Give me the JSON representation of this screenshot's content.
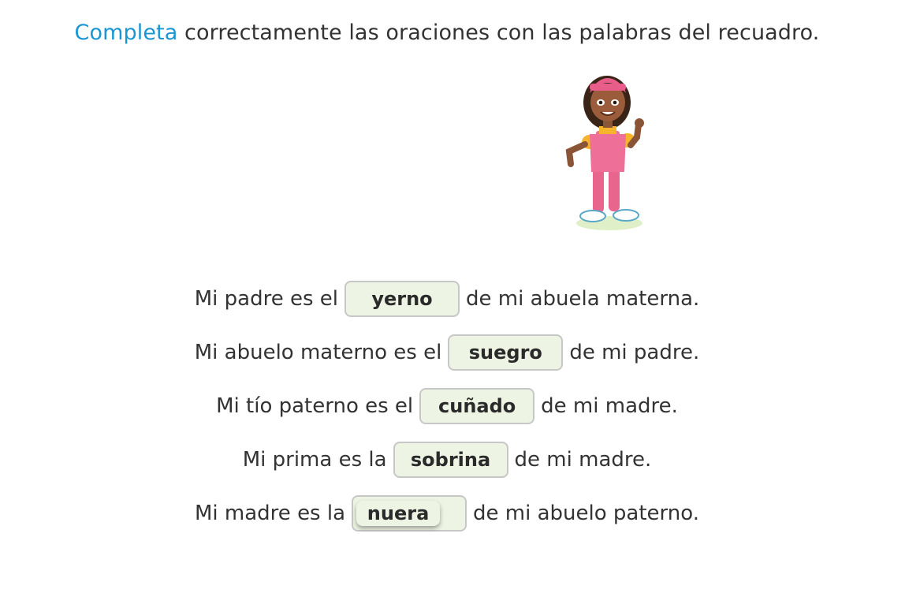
{
  "instruction": {
    "accent_word": "Completa",
    "rest": " correctamente las oraciones con las palabras del recuadro."
  },
  "character": {
    "icon": "girl-thumbs-up-illustration"
  },
  "colors": {
    "accent": "#1a96d3",
    "slot_background": "#eef4e4",
    "slot_border": "#c7c7c7"
  },
  "sentences": [
    {
      "before": "Mi padre es el",
      "answer": "yerno",
      "after": "de mi abuela materna."
    },
    {
      "before": "Mi abuelo materno es el",
      "answer": "suegro",
      "after": "de mi padre."
    },
    {
      "before": "Mi tío paterno es el",
      "answer": "cuñado",
      "after": "de mi madre."
    },
    {
      "before": "Mi prima es la",
      "answer": "sobrina",
      "after": "de mi madre."
    },
    {
      "before": "Mi madre es la",
      "answer": "nuera",
      "after": "de mi abuelo paterno."
    }
  ]
}
